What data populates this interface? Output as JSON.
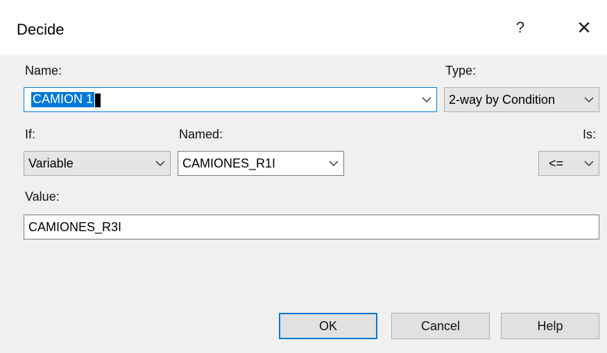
{
  "window": {
    "title": "Decide",
    "help_glyph": "?",
    "close_glyph": "✕"
  },
  "labels": {
    "name": "Name:",
    "type": "Type:",
    "if": "If:",
    "named": "Named:",
    "is": "Is:",
    "value": "Value:"
  },
  "fields": {
    "name": "CAMION 1",
    "type": "2-way by Condition",
    "if": "Variable",
    "named": "CAMIONES_R1I",
    "is": "<=",
    "value": "CAMIONES_R3I"
  },
  "buttons": {
    "ok": "OK",
    "cancel": "Cancel",
    "help": "Help"
  },
  "colors": {
    "accent": "#0078d7",
    "dialog_bg": "#f0f0f0"
  },
  "icons": {
    "dropdown": "chevron-down-icon",
    "help": "question-icon",
    "close": "close-icon"
  }
}
